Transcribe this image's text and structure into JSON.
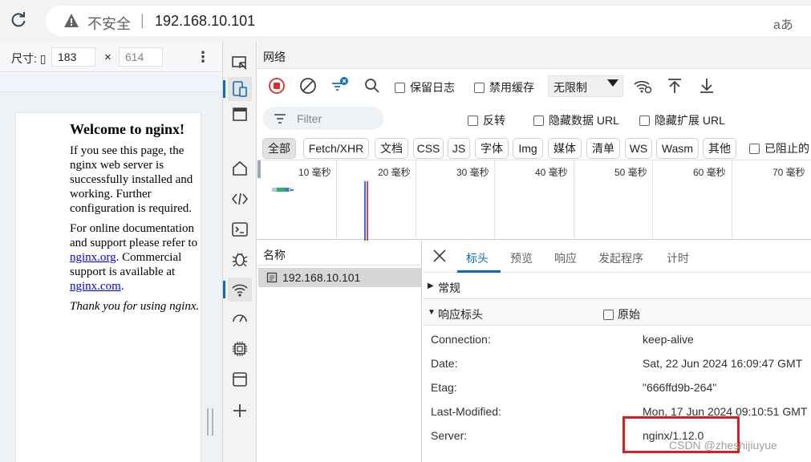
{
  "browser": {
    "security_label": "不安全",
    "separator": "|",
    "url": "192.168.10.101",
    "read_aloud": "aあ"
  },
  "device_toolbar": {
    "dimensions_label": "尺寸: ▯",
    "width": "183",
    "height": "614",
    "times": "×",
    "more": "⋮"
  },
  "nginx_page": {
    "title": "Welcome to nginx!",
    "p1": "If you see this page, the nginx web server is successfully installed and working. Further configuration is required.",
    "p2_before": "For online documentation and support please refer to ",
    "link1": "nginx.org",
    "p2_mid": ". Commercial support is available at ",
    "link2": "nginx.com",
    "p2_end": ".",
    "p3": "Thank you for using nginx."
  },
  "devtools": {
    "panel_title": "网络",
    "preserve_log": "保留日志",
    "disable_cache": "禁用缓存",
    "throttle": "无限制",
    "filter_placeholder": "Filter",
    "invert": "反转",
    "hide_data_urls": "隐藏数据 URL",
    "hide_ext_urls": "隐藏扩展 URL",
    "type_filters": [
      "全部",
      "Fetch/XHR",
      "文档",
      "CSS",
      "JS",
      "字体",
      "Img",
      "媒体",
      "清单",
      "WS",
      "Wasm",
      "其他"
    ],
    "blocked": "已阻止的",
    "timeline_labels": [
      "10 毫秒",
      "20 毫秒",
      "30 毫秒",
      "40 毫秒",
      "50 毫秒",
      "60 毫秒",
      "70 毫秒"
    ],
    "name_column": "名称",
    "request": "192.168.10.101",
    "tabs": [
      "标头",
      "预览",
      "响应",
      "发起程序",
      "计时"
    ],
    "general": "常规",
    "response_headers": "响应标头",
    "raw": "原始",
    "headers": [
      {
        "name": "Connection:",
        "value": "keep-alive"
      },
      {
        "name": "Date:",
        "value": "Sat, 22 Jun 2024 16:09:47 GMT"
      },
      {
        "name": "Etag:",
        "value": "\"666ffd9b-264\""
      },
      {
        "name": "Last-Modified:",
        "value": "Mon, 17 Jun 2024 09:10:51 GMT"
      },
      {
        "name": "Server:",
        "value": "nginx/1.12.0"
      }
    ]
  },
  "watermark": "CSDN @zheshijiuyue"
}
